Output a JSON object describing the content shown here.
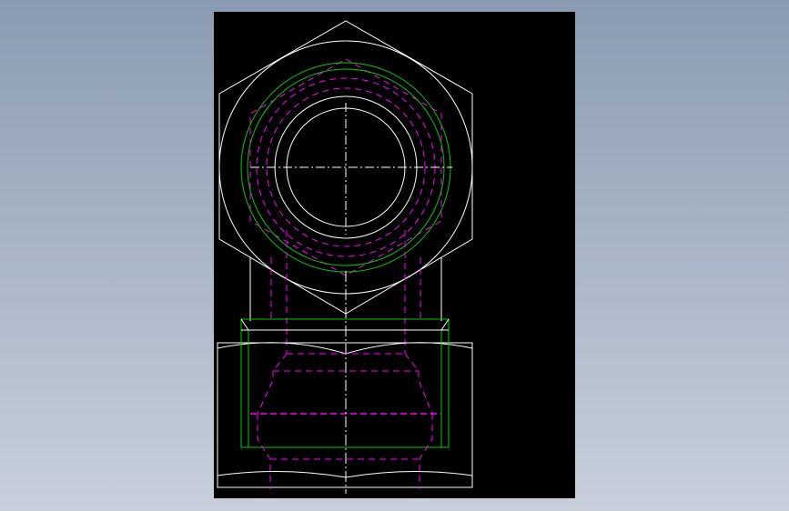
{
  "drawing": {
    "background_color": "#000000",
    "line_colors": {
      "visible_edges": "#ffffff",
      "hidden_edges": "#ff00ff",
      "thread_outline": "#00cc00",
      "centerlines": "#ffffff"
    }
  }
}
